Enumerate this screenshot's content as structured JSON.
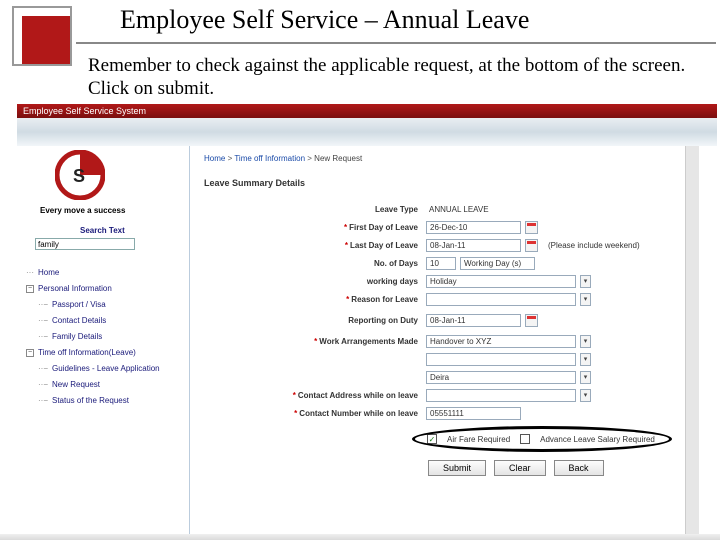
{
  "title": "Employee Self Service – Annual Leave",
  "subtitle": "Remember to check against the applicable request, at the bottom of the screen. Click on submit.",
  "appbar": "Employee Self Service System",
  "sidebar": {
    "tagline": "Every move a success",
    "search_label": "Search Text",
    "search_value": "family",
    "tree": {
      "home": "Home",
      "personal": "Personal Information",
      "passport": "Passport / Visa",
      "contact": "Contact Details",
      "family": "Family Details",
      "timeoff": "Time off Information(Leave)",
      "guidelines": "Guidelines - Leave Application",
      "newreq": "New Request",
      "status": "Status of the Request"
    }
  },
  "crumb": {
    "home": "Home",
    "timeoff": "Time off Information",
    "current": "New Request"
  },
  "section": "Leave Summary Details",
  "form": {
    "leave_type_lbl": "Leave Type",
    "leave_type_val": "ANNUAL LEAVE",
    "first_day_lbl": "First Day of Leave",
    "first_day_val": "26-Dec-10",
    "last_day_lbl": "Last Day of Leave",
    "last_day_val": "08-Jan-11",
    "include_weekend": "(Please include weekend)",
    "no_days_lbl": "No. of Days",
    "no_days_val": "10",
    "working_days_suffix": "Working Day (s)",
    "working_days_lbl": "working days",
    "working_days_val": "Holiday",
    "reason_lbl": "Reason for Leave",
    "reporting_lbl": "Reporting on Duty",
    "reporting_val": "08-Jan-11",
    "work_arr_lbl": "Work Arrangements Made",
    "work_arr_val": "Handover to XYZ",
    "addr_row_val": "Deira",
    "contact_addr_lbl": "Contact Address while on leave",
    "contact_num_lbl": "Contact Number while on leave",
    "contact_num_val": "05551111"
  },
  "checks": {
    "airfare": "Air Fare Required",
    "advance": "Advance Leave Salary Required"
  },
  "buttons": {
    "submit": "Submit",
    "clear": "Clear",
    "back": "Back"
  }
}
